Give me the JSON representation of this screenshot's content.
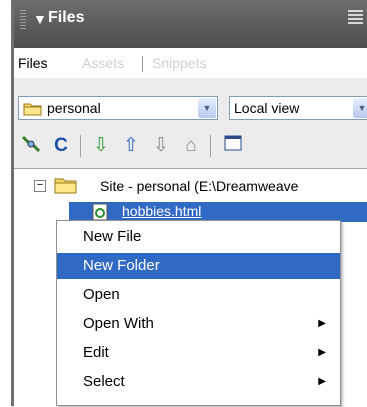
{
  "panel": {
    "title": "Files",
    "tabs": [
      "Files",
      "Assets",
      "Snippets"
    ]
  },
  "site_select": {
    "value": "personal"
  },
  "view_select": {
    "value": "Local view"
  },
  "toolbar": {
    "icons": [
      "connect-icon",
      "refresh-icon",
      "get-icon",
      "put-icon",
      "check-out-icon",
      "check-in-icon",
      "expand-icon"
    ]
  },
  "tree": {
    "site_label": "Site - personal (E:\\Dreamweave",
    "file_label": "hobbies.html"
  },
  "context_menu": {
    "items": [
      {
        "label": "New File",
        "submenu": false
      },
      {
        "label": "New Folder",
        "submenu": false,
        "highlighted": true
      },
      {
        "label": "Open",
        "submenu": false
      },
      {
        "label": "Open With",
        "submenu": true
      },
      {
        "label": "Edit",
        "submenu": true
      },
      {
        "label": "Select",
        "submenu": true
      }
    ]
  },
  "colors": {
    "titlebar": "#5a5a5a",
    "selection": "#316ac5",
    "tab_inactive_text": "#cfcfcf"
  }
}
